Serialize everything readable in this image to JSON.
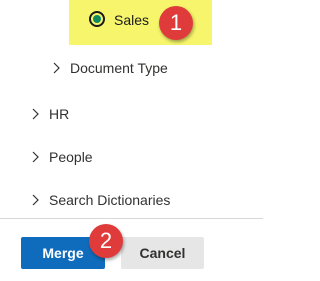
{
  "selected_option": {
    "label": "Sales",
    "icon": "radio-selected-icon",
    "highlight_color": "#f6f56b"
  },
  "tree": {
    "items": [
      {
        "label": "Document Type",
        "icon": "chevron-right-icon"
      },
      {
        "label": "HR",
        "icon": "chevron-right-icon"
      },
      {
        "label": "People",
        "icon": "chevron-right-icon"
      },
      {
        "label": "Search Dictionaries",
        "icon": "chevron-right-icon"
      }
    ]
  },
  "actions": {
    "merge_label": "Merge",
    "cancel_label": "Cancel",
    "primary_color": "#0f6cbd"
  },
  "callouts": {
    "first": "1",
    "second": "2",
    "color": "#e03b3b"
  }
}
